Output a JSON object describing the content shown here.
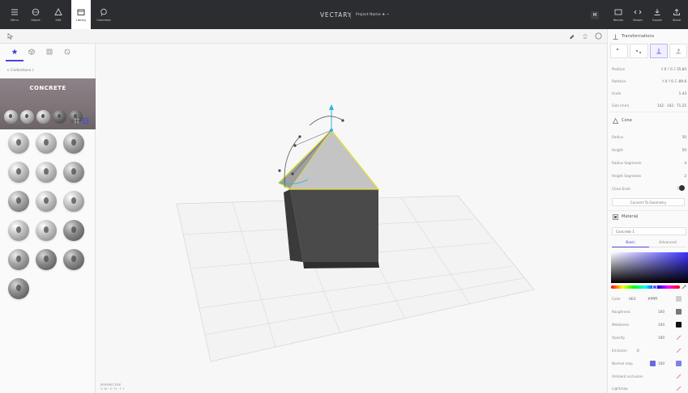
{
  "topbar": {
    "left_items": [
      {
        "label": "Menu",
        "icon": "hamburger-icon"
      },
      {
        "label": "Object",
        "icon": "object-icon"
      },
      {
        "label": "Edit",
        "icon": "edit-icon"
      },
      {
        "label": "Library",
        "icon": "library-icon",
        "active": true
      },
      {
        "label": "Comment",
        "icon": "comment-icon"
      }
    ],
    "brand": "VECTARY",
    "project_name": "Project Name ★ ~",
    "avatar": "M",
    "right_items": [
      {
        "label": "Render",
        "icon": "render-icon"
      },
      {
        "label": "Viewer",
        "icon": "viewer-icon"
      },
      {
        "label": "Export",
        "icon": "export-icon"
      },
      {
        "label": "Share",
        "icon": "share-icon"
      }
    ]
  },
  "library": {
    "breadcrumb": "< Collections /",
    "collection_title": "CONCRETE",
    "materials_label": "Materials"
  },
  "viewport": {
    "perspective_label": "PERSPECTIVE",
    "stats": "V: 46 · E: 74 · T: 1"
  },
  "inspector": {
    "transformations": {
      "title": "Transformations",
      "position": {
        "label": "Position",
        "x": "0",
        "y": "0",
        "z": "35.84"
      },
      "rotation": {
        "label": "Rotation",
        "x": "0",
        "y": "0",
        "z": "-89.8"
      },
      "scale": {
        "label": "Scale",
        "value": "1.43"
      },
      "size": {
        "label": "Size (mm)",
        "x": "142",
        "y": "142",
        "z": "71.25"
      }
    },
    "cone": {
      "title": "Cone",
      "radius": {
        "label": "Radius",
        "value": "50"
      },
      "height": {
        "label": "Height",
        "value": "50"
      },
      "radius_segments": {
        "label": "Radius Segments",
        "value": "4"
      },
      "height_segments": {
        "label": "Height Segments",
        "value": "2"
      },
      "close_ends": {
        "label": "Close Ends"
      },
      "convert_label": "Convert To Geometry"
    },
    "material": {
      "title": "Material",
      "selected": "Concrete 1",
      "tabs": [
        "Basic",
        "Advanced"
      ],
      "color": {
        "label": "Color",
        "mode": "HEX",
        "hex": "#ffffff"
      },
      "roughness": {
        "label": "Roughness",
        "value": "100"
      },
      "metalness": {
        "label": "Metalness",
        "value": "100"
      },
      "opacity": {
        "label": "Opacity",
        "value": "100"
      },
      "emission": {
        "label": "Emission",
        "value": "0"
      },
      "normal_map": {
        "label": "Normal map",
        "value": "100"
      },
      "ambient_occlusion": {
        "label": "Ambient occlusion"
      },
      "lightmap": {
        "label": "Lightmap"
      }
    }
  },
  "colors": {
    "accent": "#4a47d6",
    "topbar_bg": "#2c2d30",
    "selection_outline": "#e6e23a",
    "gizmo_axis": "#29b6d8"
  }
}
